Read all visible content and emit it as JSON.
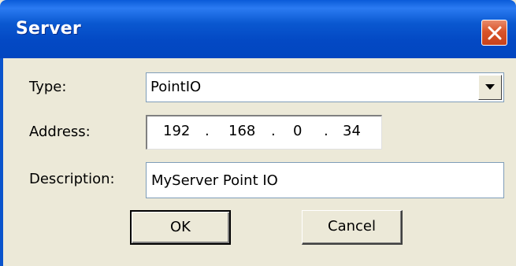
{
  "window": {
    "title": "Server",
    "close_icon": "close-x-icon",
    "title_bar_color": "#0a58d0",
    "body_color": "#ece9d8"
  },
  "form": {
    "type_label": "Type:",
    "type_value": "PointIO",
    "type_dropdown_icon": "dropdown-arrow-icon",
    "address_label": "Address:",
    "address_octets": [
      "192",
      "168",
      "0",
      "34"
    ],
    "address_separator": ".",
    "description_label": "Description:",
    "description_value": "MyServer Point IO"
  },
  "buttons": {
    "ok_label": "OK",
    "cancel_label": "Cancel"
  }
}
